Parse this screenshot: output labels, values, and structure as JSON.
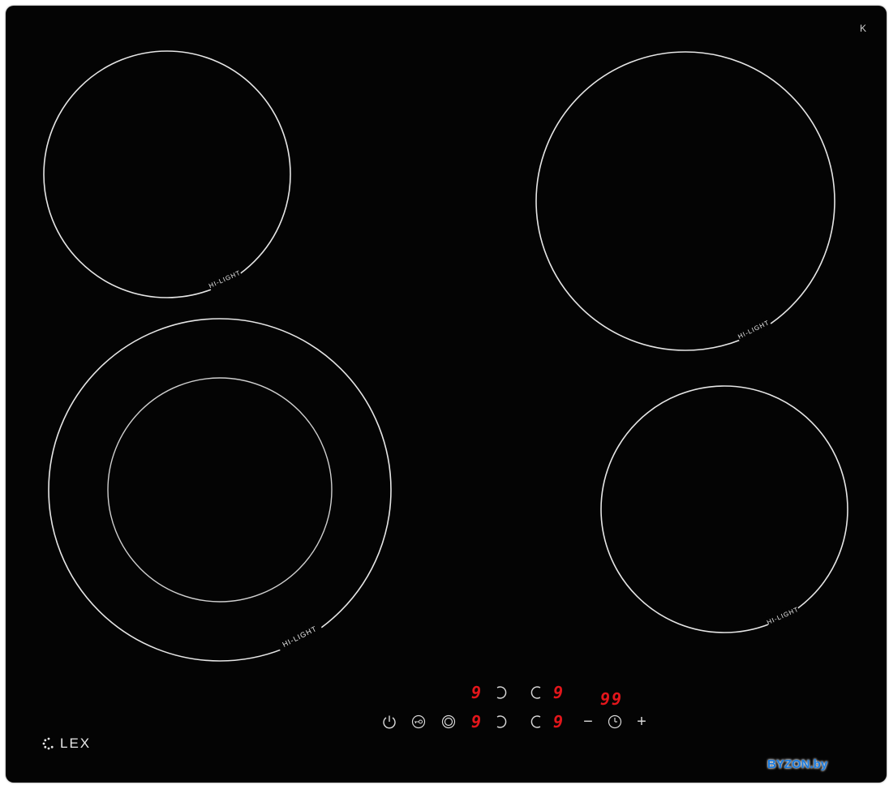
{
  "brand": {
    "name": "LEX"
  },
  "corner_mark": "K",
  "zones": {
    "rear_left_label": "HI-LIGHT",
    "front_left_label": "HI-LIGHT",
    "rear_right_label": "HI-LIGHT",
    "front_right_label": "HI-LIGHT"
  },
  "controls": {
    "zone_levels": {
      "rear_left": "9",
      "rear_right": "9",
      "front_left": "9",
      "front_right": "9"
    },
    "timer_display": "99",
    "minus_symbol": "−",
    "plus_symbol": "+"
  },
  "watermark": "BYZON.by",
  "colors": {
    "glass": "#040404",
    "ring": "#e6e6e6",
    "display": "#e3161b",
    "watermark": "#1a7be0"
  }
}
